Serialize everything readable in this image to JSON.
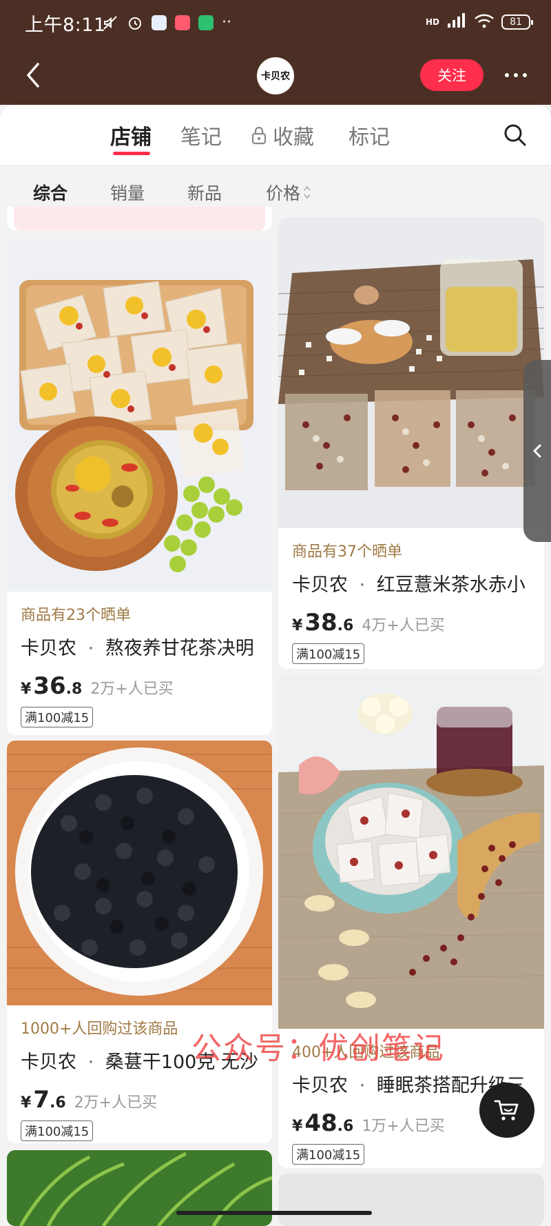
{
  "status_bar": {
    "time": "上午8:11",
    "battery": "81",
    "network": "HD"
  },
  "header": {
    "shop_logo_text": "卡贝农",
    "follow_label": "关注"
  },
  "tabs": [
    {
      "label": "店铺",
      "active": true
    },
    {
      "label": "笔记",
      "active": false
    },
    {
      "label": "收藏",
      "active": false,
      "locked": true
    },
    {
      "label": "标记",
      "active": false
    }
  ],
  "sort": [
    {
      "label": "综合",
      "active": true
    },
    {
      "label": "销量",
      "active": false
    },
    {
      "label": "新品",
      "active": false
    },
    {
      "label": "价格",
      "active": false,
      "has_arrows": true
    }
  ],
  "products": [
    {
      "hint": "商品有23个晒单",
      "shop": "卡贝农",
      "title": "熬夜养甘花茶决明",
      "price_int": "36",
      "price_dec": ".8",
      "sold": "2万+人已买",
      "coupon": "满100减15"
    },
    {
      "hint": "商品有37个晒单",
      "shop": "卡贝农",
      "title": "红豆薏米茶水赤小",
      "price_int": "38",
      "price_dec": ".6",
      "sold": "4万+人已买",
      "coupon": "满100减15"
    },
    {
      "hint": "1000+人回购过该商品",
      "shop": "卡贝农",
      "title": "桑葚干100克 无沙",
      "price_int": "7",
      "price_dec": ".6",
      "sold": "2万+人已买",
      "coupon": "满100减15"
    },
    {
      "hint": "400+人回购过该商品",
      "shop": "卡贝农",
      "title": "睡眠茶搭配升级三",
      "price_int": "48",
      "price_dec": ".6",
      "sold": "1万+人已买",
      "coupon": "满100减15"
    }
  ],
  "currency": "¥",
  "watermark": "公众号：优创笔记",
  "colors": {
    "header_bg": "#4c2f24",
    "accent": "#ff2e4d",
    "hint": "#a07a46"
  }
}
